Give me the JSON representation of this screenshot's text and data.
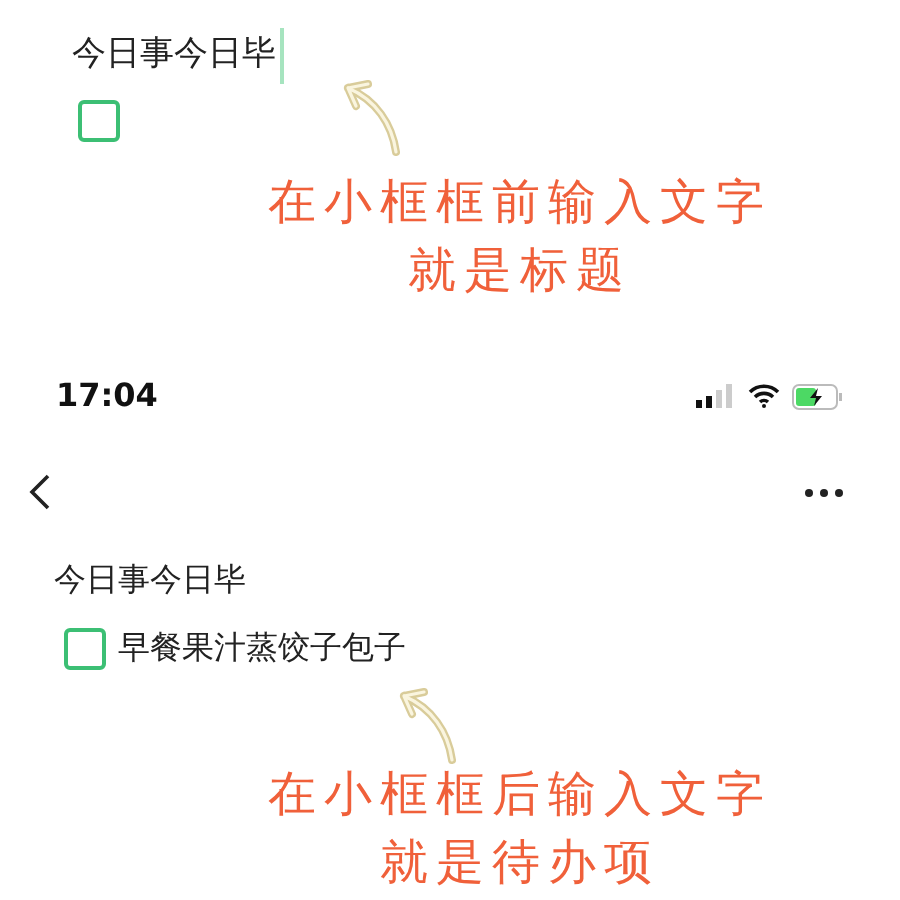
{
  "example_top": {
    "title": "今日事今日毕",
    "cursor": true,
    "checkbox": {
      "checked": false
    },
    "annotation": [
      "在小框框前输入文字",
      "就是标题"
    ]
  },
  "screen": {
    "status_bar": {
      "time": "17:04",
      "battery": {
        "charging": true
      }
    },
    "note": {
      "title": "今日事今日毕",
      "todos": [
        {
          "text": "早餐果汁蒸饺子包子",
          "checked": false
        }
      ]
    },
    "annotation": [
      "在小框框后输入文字",
      "就是待办项"
    ]
  }
}
